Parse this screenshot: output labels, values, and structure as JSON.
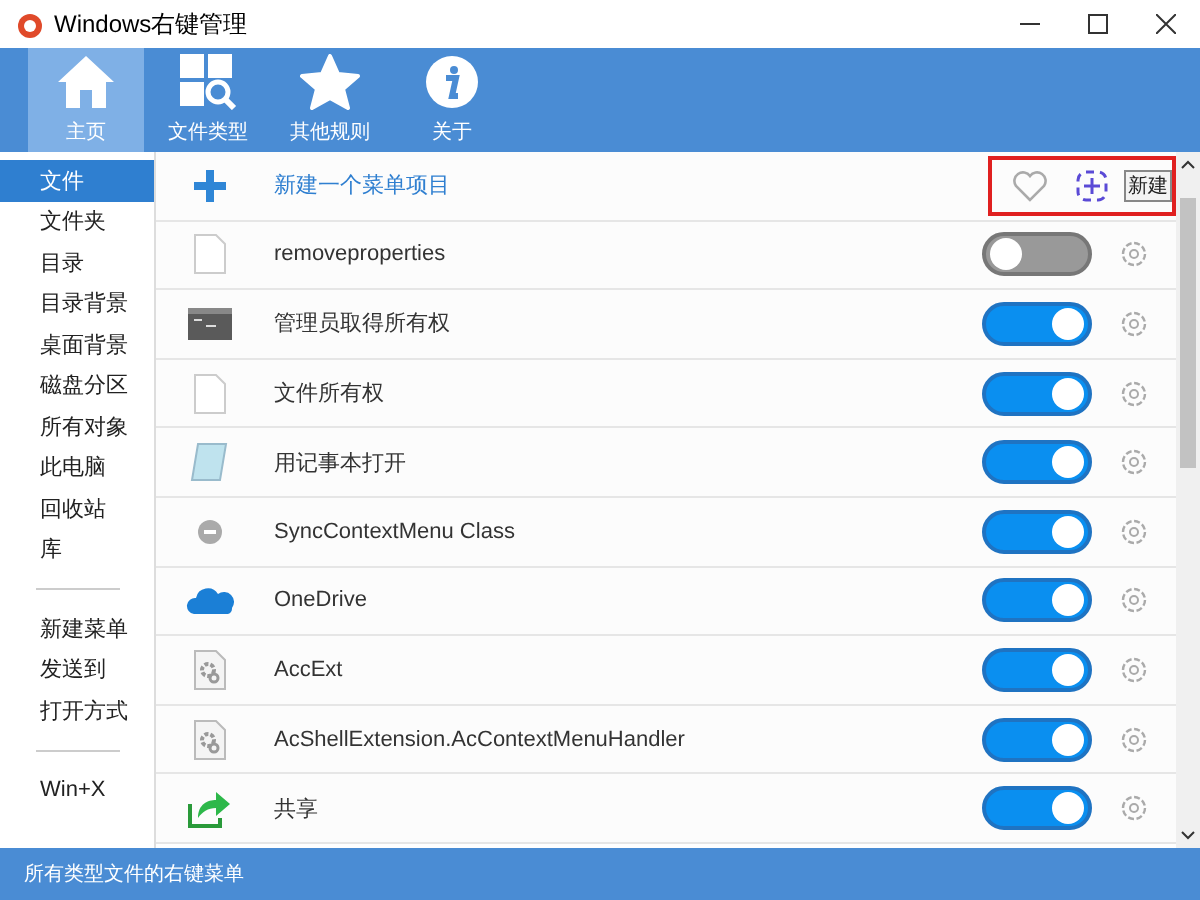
{
  "window": {
    "title": "Windows右键管理"
  },
  "toolbar": [
    {
      "label": "主页",
      "kind": "home",
      "selected": true
    },
    {
      "label": "文件类型",
      "kind": "types",
      "selected": false
    },
    {
      "label": "其他规则",
      "kind": "star",
      "selected": false
    },
    {
      "label": "关于",
      "kind": "info",
      "selected": false
    }
  ],
  "sidebar": {
    "groups": [
      [
        {
          "label": "文件",
          "selected": true
        },
        {
          "label": "文件夹",
          "selected": false
        },
        {
          "label": "目录",
          "selected": false
        },
        {
          "label": "目录背景",
          "selected": false
        },
        {
          "label": "桌面背景",
          "selected": false
        },
        {
          "label": "磁盘分区",
          "selected": false
        },
        {
          "label": "所有对象",
          "selected": false
        },
        {
          "label": "此电脑",
          "selected": false
        },
        {
          "label": "回收站",
          "selected": false
        },
        {
          "label": "库",
          "selected": false
        }
      ],
      [
        {
          "label": "新建菜单",
          "selected": false
        },
        {
          "label": "发送到",
          "selected": false
        },
        {
          "label": "打开方式",
          "selected": false
        }
      ],
      [
        {
          "label": "Win+X",
          "selected": false
        }
      ]
    ]
  },
  "new_item": {
    "label": "新建一个菜单项目",
    "tooltip": "新建"
  },
  "items": [
    {
      "name": "removeproperties",
      "kind": "file",
      "on": false
    },
    {
      "name": "管理员取得所有权",
      "kind": "console",
      "on": true
    },
    {
      "name": "文件所有权",
      "kind": "file",
      "on": true
    },
    {
      "name": "用记事本打开",
      "kind": "notepad",
      "on": true
    },
    {
      "name": "SyncContextMenu Class",
      "kind": "minus",
      "on": true
    },
    {
      "name": "OneDrive",
      "kind": "cloud",
      "on": true
    },
    {
      "name": "AccExt",
      "kind": "gearfile",
      "on": true
    },
    {
      "name": "AcShellExtension.AcContextMenuHandler",
      "kind": "gearfile",
      "on": true
    },
    {
      "name": "共享",
      "kind": "share",
      "on": true
    }
  ],
  "status_bar": "所有类型文件的右键菜单"
}
